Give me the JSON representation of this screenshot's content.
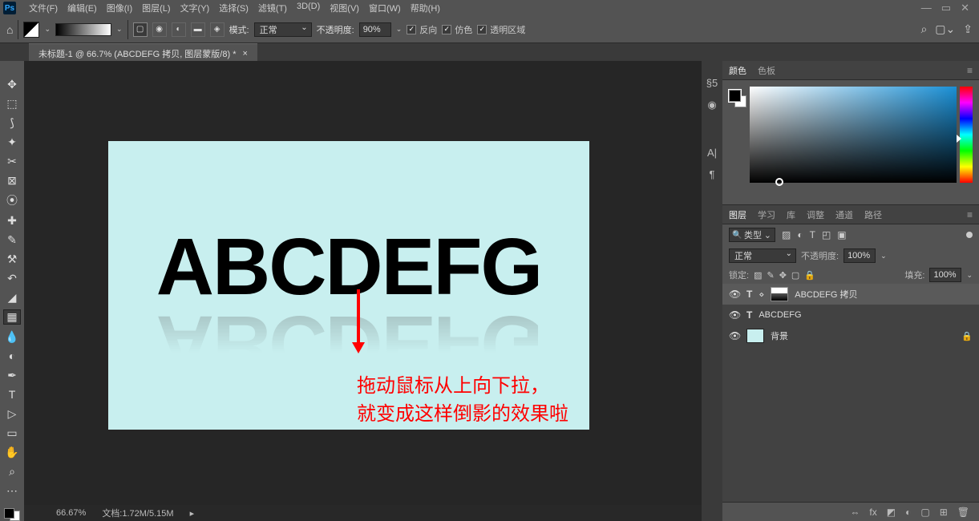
{
  "menu": {
    "items": [
      "文件(F)",
      "编辑(E)",
      "图像(I)",
      "图层(L)",
      "文字(Y)",
      "选择(S)",
      "滤镜(T)",
      "3D(D)",
      "视图(V)",
      "窗口(W)",
      "帮助(H)"
    ]
  },
  "options": {
    "mode_label": "模式:",
    "mode_value": "正常",
    "opacity_label": "不透明度:",
    "opacity_value": "90%",
    "reverse_label": "反向",
    "dither_label": "仿色",
    "transparency_label": "透明区域"
  },
  "doc": {
    "tab_title": "未标题-1 @ 66.7% (ABCDEFG 拷贝, 图层蒙版/8) *",
    "canvas_text": "ABCDEFG",
    "annotation1": "拖动鼠标从上向下拉，",
    "annotation2": "就变成这样倒影的效果啦"
  },
  "status": {
    "zoom": "66.67%",
    "docinfo": "文档:1.72M/5.15M"
  },
  "color_panel": {
    "tabs": [
      "颜色",
      "色板"
    ]
  },
  "layers_panel": {
    "tabs": [
      "图层",
      "学习",
      "库",
      "调整",
      "通道",
      "路径"
    ],
    "filter_mode": "类型",
    "blend_mode": "正常",
    "opacity_label": "不透明度:",
    "opacity_value": "100%",
    "lock_label": "锁定:",
    "fill_label": "填充:",
    "fill_value": "100%",
    "layers": [
      {
        "name": "ABCDEFG 拷贝",
        "type": "text",
        "mask": true,
        "selected": true
      },
      {
        "name": "ABCDEFG",
        "type": "text",
        "mask": false,
        "selected": false
      },
      {
        "name": "背景",
        "type": "raster",
        "mask": false,
        "locked": true,
        "selected": false
      }
    ]
  }
}
